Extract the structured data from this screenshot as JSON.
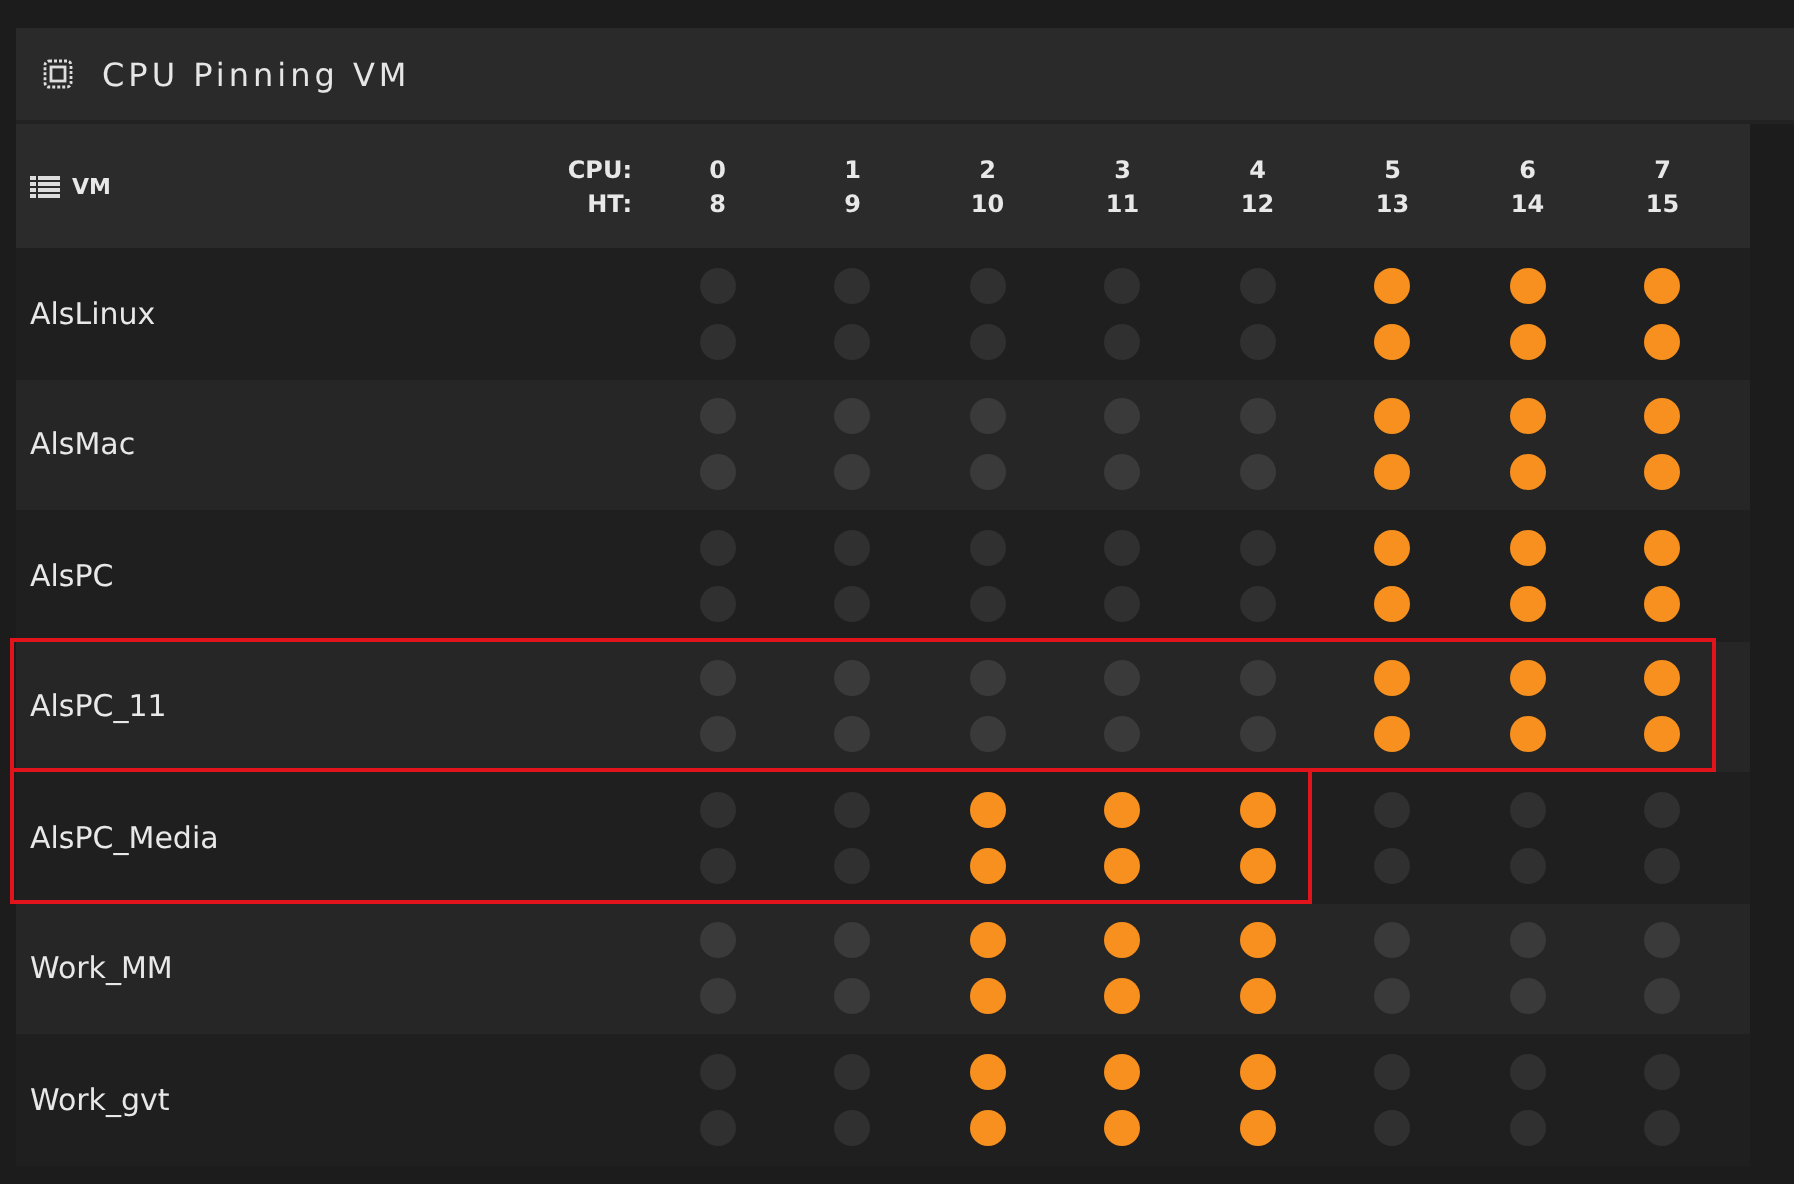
{
  "panel": {
    "title": "CPU Pinning VM"
  },
  "header": {
    "vm_label": "VM",
    "cpu_label": "CPU:",
    "ht_label": "HT:",
    "cores": [
      {
        "cpu": "0",
        "ht": "8"
      },
      {
        "cpu": "1",
        "ht": "9"
      },
      {
        "cpu": "2",
        "ht": "10"
      },
      {
        "cpu": "3",
        "ht": "11"
      },
      {
        "cpu": "4",
        "ht": "12"
      },
      {
        "cpu": "5",
        "ht": "13"
      },
      {
        "cpu": "6",
        "ht": "14"
      },
      {
        "cpu": "7",
        "ht": "15"
      }
    ]
  },
  "rows": [
    {
      "name": "AlsLinux",
      "highlighted": false,
      "cpu_pins": [
        false,
        false,
        false,
        false,
        false,
        true,
        true,
        true
      ],
      "ht_pins": [
        false,
        false,
        false,
        false,
        false,
        true,
        true,
        true
      ]
    },
    {
      "name": "AlsMac",
      "highlighted": false,
      "cpu_pins": [
        false,
        false,
        false,
        false,
        false,
        true,
        true,
        true
      ],
      "ht_pins": [
        false,
        false,
        false,
        false,
        false,
        true,
        true,
        true
      ]
    },
    {
      "name": "AlsPC",
      "highlighted": false,
      "cpu_pins": [
        false,
        false,
        false,
        false,
        false,
        true,
        true,
        true
      ],
      "ht_pins": [
        false,
        false,
        false,
        false,
        false,
        true,
        true,
        true
      ]
    },
    {
      "name": "AlsPC_11",
      "highlighted": true,
      "cpu_pins": [
        false,
        false,
        false,
        false,
        false,
        true,
        true,
        true
      ],
      "ht_pins": [
        false,
        false,
        false,
        false,
        false,
        true,
        true,
        true
      ]
    },
    {
      "name": "AlsPC_Media",
      "highlighted": true,
      "cpu_pins": [
        false,
        false,
        true,
        true,
        true,
        false,
        false,
        false
      ],
      "ht_pins": [
        false,
        false,
        true,
        true,
        true,
        false,
        false,
        false
      ]
    },
    {
      "name": "Work_MM",
      "highlighted": false,
      "cpu_pins": [
        false,
        false,
        true,
        true,
        true,
        false,
        false,
        false
      ],
      "ht_pins": [
        false,
        false,
        true,
        true,
        true,
        false,
        false,
        false
      ]
    },
    {
      "name": "Work_gvt",
      "highlighted": false,
      "cpu_pins": [
        false,
        false,
        true,
        true,
        true,
        false,
        false,
        false
      ],
      "ht_pins": [
        false,
        false,
        true,
        true,
        true,
        false,
        false,
        false
      ]
    }
  ]
}
